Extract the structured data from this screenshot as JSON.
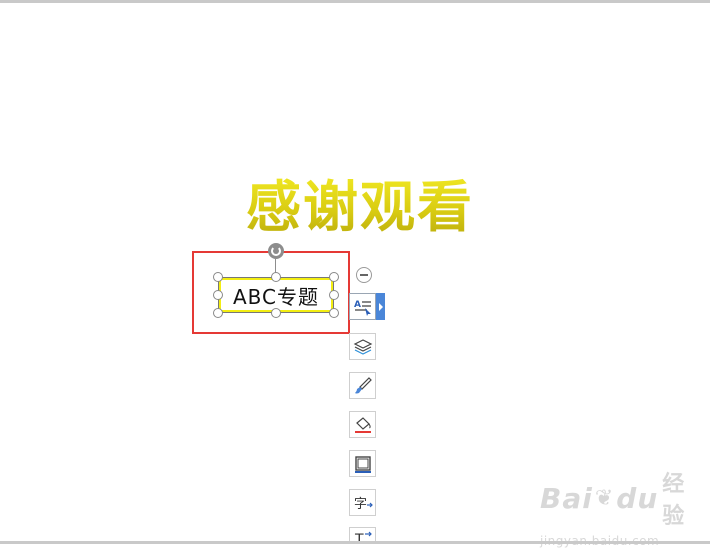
{
  "slide": {
    "title": "感谢观看",
    "textbox_text": "ABC专题",
    "colors": {
      "title": "#d6cf14",
      "selection_outline": "#e53935",
      "textbox_fill_border": "#f3ee12"
    }
  },
  "toolbar": {
    "buttons": [
      {
        "name": "text-format-icon"
      },
      {
        "name": "layers-icon"
      },
      {
        "name": "brush-icon"
      },
      {
        "name": "fill-bucket-icon"
      },
      {
        "name": "outline-border-icon"
      },
      {
        "name": "character-spacing-icon"
      },
      {
        "name": "text-box-icon"
      }
    ]
  },
  "watermark": {
    "logo": "Bai",
    "logo_suffix": "du",
    "logo_cn": "经验",
    "url": "jingyan.baidu.com"
  }
}
